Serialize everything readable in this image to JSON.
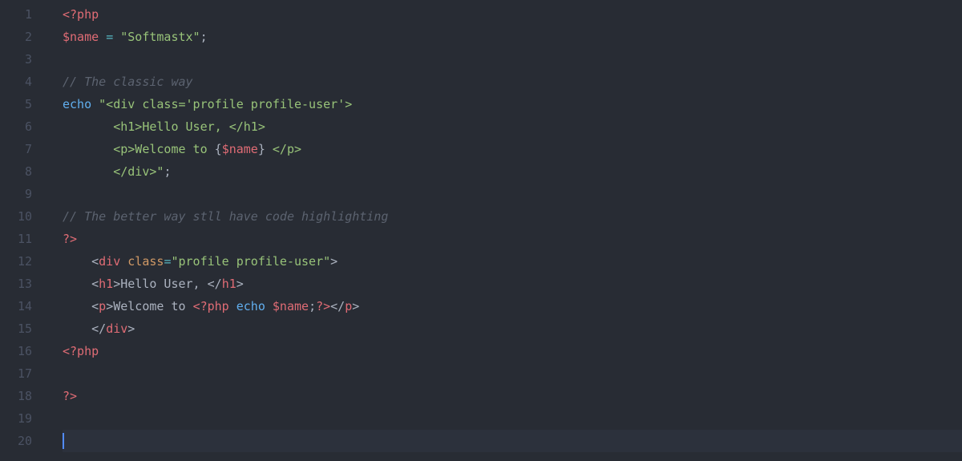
{
  "colors": {
    "background": "#282c34",
    "gutter_fg": "#4b5263",
    "active_line_bg": "#2c313c",
    "cursor": "#528bff",
    "default": "#abb2bf",
    "phptag": "#e06c75",
    "var": "#e06c75",
    "operator": "#56b6c2",
    "string": "#98c379",
    "comment": "#5c6370",
    "keyword": "#61afef",
    "tag": "#e06c75",
    "attr": "#d19a66"
  },
  "gutter": [
    "1",
    "2",
    "3",
    "4",
    "5",
    "6",
    "7",
    "8",
    "9",
    "10",
    "11",
    "12",
    "13",
    "14",
    "15",
    "16",
    "17",
    "18",
    "19",
    "20"
  ],
  "active_line": 20,
  "lines": [
    [
      {
        "cls": "tk-phptag",
        "t": "<?php"
      }
    ],
    [
      {
        "cls": "tk-var",
        "t": "$name"
      },
      {
        "cls": "tk-semi",
        "t": " "
      },
      {
        "cls": "tk-op",
        "t": "="
      },
      {
        "cls": "tk-semi",
        "t": " "
      },
      {
        "cls": "tk-str",
        "t": "\"Softmastx\""
      },
      {
        "cls": "tk-semi",
        "t": ";"
      }
    ],
    [],
    [
      {
        "cls": "tk-comment",
        "t": "// The classic way"
      }
    ],
    [
      {
        "cls": "tk-kw",
        "t": "echo"
      },
      {
        "cls": "tk-semi",
        "t": " "
      },
      {
        "cls": "tk-str",
        "t": "\"<div class='profile profile-user'>"
      }
    ],
    [
      {
        "cls": "tk-str",
        "t": "       <h1>Hello User, </h1>"
      }
    ],
    [
      {
        "cls": "tk-str",
        "t": "       <p>Welcome to "
      },
      {
        "cls": "tk-embed",
        "t": "{"
      },
      {
        "cls": "tk-var",
        "t": "$name"
      },
      {
        "cls": "tk-embed",
        "t": "}"
      },
      {
        "cls": "tk-str",
        "t": " </p>"
      }
    ],
    [
      {
        "cls": "tk-str",
        "t": "       </div>\""
      },
      {
        "cls": "tk-semi",
        "t": ";"
      }
    ],
    [],
    [
      {
        "cls": "tk-comment",
        "t": "// The better way stll have code highlighting"
      }
    ],
    [
      {
        "cls": "tk-phptag",
        "t": "?>"
      }
    ],
    [
      {
        "cls": "tk-text",
        "t": "    "
      },
      {
        "cls": "tk-punct",
        "t": "<"
      },
      {
        "cls": "tk-tag",
        "t": "div"
      },
      {
        "cls": "tk-text",
        "t": " "
      },
      {
        "cls": "tk-attr",
        "t": "class"
      },
      {
        "cls": "tk-op",
        "t": "="
      },
      {
        "cls": "tk-str",
        "t": "\"profile profile-user\""
      },
      {
        "cls": "tk-punct",
        "t": ">"
      }
    ],
    [
      {
        "cls": "tk-text",
        "t": "    "
      },
      {
        "cls": "tk-punct",
        "t": "<"
      },
      {
        "cls": "tk-tag",
        "t": "h1"
      },
      {
        "cls": "tk-punct",
        "t": ">"
      },
      {
        "cls": "tk-text",
        "t": "Hello User, "
      },
      {
        "cls": "tk-punct",
        "t": "</"
      },
      {
        "cls": "tk-tag",
        "t": "h1"
      },
      {
        "cls": "tk-punct",
        "t": ">"
      }
    ],
    [
      {
        "cls": "tk-text",
        "t": "    "
      },
      {
        "cls": "tk-punct",
        "t": "<"
      },
      {
        "cls": "tk-tag",
        "t": "p"
      },
      {
        "cls": "tk-punct",
        "t": ">"
      },
      {
        "cls": "tk-text",
        "t": "Welcome to "
      },
      {
        "cls": "tk-phptag",
        "t": "<?php"
      },
      {
        "cls": "tk-text",
        "t": " "
      },
      {
        "cls": "tk-kw",
        "t": "echo"
      },
      {
        "cls": "tk-text",
        "t": " "
      },
      {
        "cls": "tk-var",
        "t": "$name"
      },
      {
        "cls": "tk-semi",
        "t": ";"
      },
      {
        "cls": "tk-phptag",
        "t": "?>"
      },
      {
        "cls": "tk-punct",
        "t": "</"
      },
      {
        "cls": "tk-tag",
        "t": "p"
      },
      {
        "cls": "tk-punct",
        "t": ">"
      }
    ],
    [
      {
        "cls": "tk-text",
        "t": "    "
      },
      {
        "cls": "tk-punct",
        "t": "</"
      },
      {
        "cls": "tk-tag",
        "t": "div"
      },
      {
        "cls": "tk-punct",
        "t": ">"
      }
    ],
    [
      {
        "cls": "tk-phptag",
        "t": "<?php"
      }
    ],
    [],
    [
      {
        "cls": "tk-phptag",
        "t": "?>"
      }
    ],
    [],
    []
  ]
}
